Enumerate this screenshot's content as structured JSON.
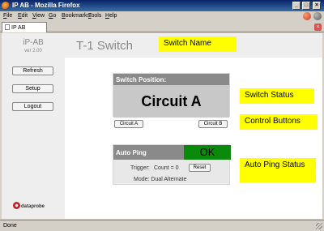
{
  "window": {
    "title": "IP AB - Mozilla Firefox",
    "min": "_",
    "max": "□",
    "close": "×"
  },
  "menu": [
    "File",
    "Edit",
    "View",
    "Go",
    "Bookmarks",
    "Tools",
    "Help"
  ],
  "menu_accel": [
    "F",
    "E",
    "V",
    "G",
    "B",
    "T",
    "H"
  ],
  "tab": {
    "label": "IP AB"
  },
  "sidebar": {
    "brand": "iP-AB",
    "version": "ver 2.00",
    "buttons": {
      "refresh": "Refresh",
      "setup": "Setup",
      "logout": "Logout"
    },
    "logo": "dataprobe"
  },
  "header": {
    "title": "T-1 Switch"
  },
  "callouts": {
    "switch_name": "Switch Name",
    "switch_status": "Switch Status",
    "control_buttons": "Control Buttons",
    "auto_ping_status": "Auto Ping Status"
  },
  "switch_panel": {
    "heading": "Switch Position:",
    "position": "Circuit A",
    "btn_a": "Circuit A",
    "btn_b": "Circuit B"
  },
  "auto_ping": {
    "heading": "Auto Ping",
    "status": "OK",
    "trigger_label": "Trigger:",
    "trigger_value": "Count = 0",
    "reset": "Reset",
    "mode": "Mode: Dual Alternate"
  },
  "status_bar": {
    "text": "Done"
  },
  "colors": {
    "callout": "#ffff00",
    "ok": "#0a8a0a",
    "titlebar": "#0a246a"
  }
}
